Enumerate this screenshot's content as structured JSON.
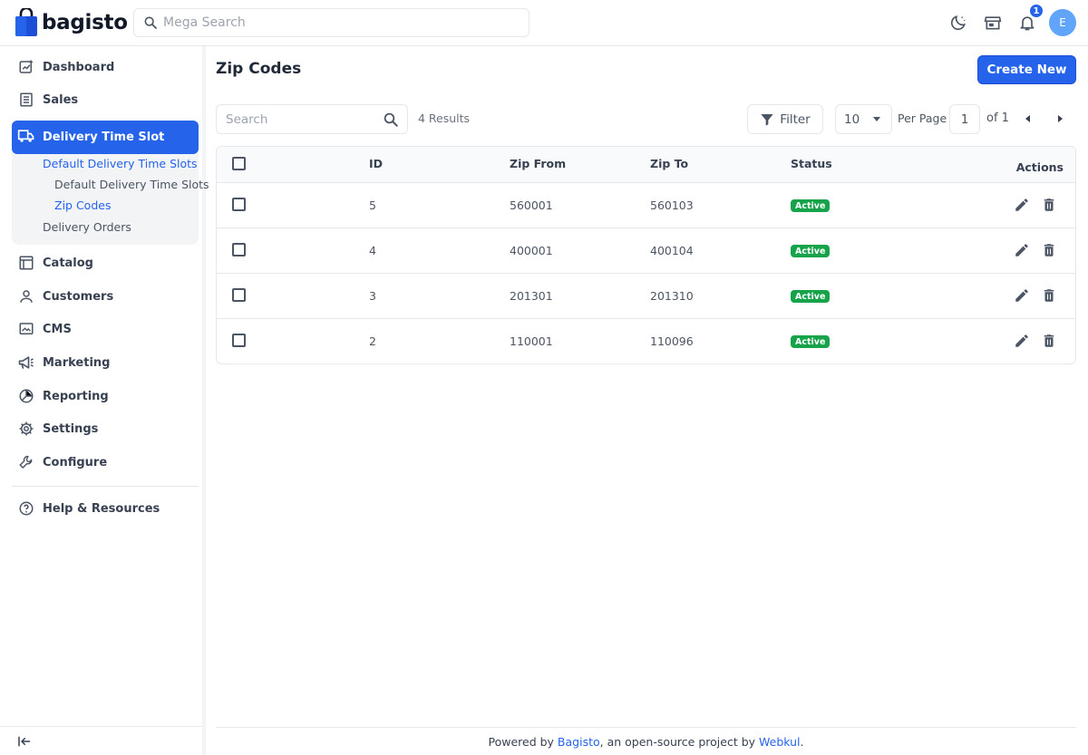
{
  "header": {
    "brand": "bagisto",
    "search_placeholder": "Mega Search",
    "notification_count": "1",
    "avatar_initial": "E"
  },
  "sidebar": {
    "items": [
      {
        "label": "Dashboard",
        "icon": "dashboard-icon"
      },
      {
        "label": "Sales",
        "icon": "sales-icon"
      },
      {
        "label": "Delivery Time Slot",
        "icon": "delivery-truck-icon"
      },
      {
        "label": "Catalog",
        "icon": "catalog-icon"
      },
      {
        "label": "Customers",
        "icon": "customers-icon"
      },
      {
        "label": "CMS",
        "icon": "cms-icon"
      },
      {
        "label": "Marketing",
        "icon": "marketing-megaphone-icon"
      },
      {
        "label": "Reporting",
        "icon": "reporting-chart-icon"
      },
      {
        "label": "Settings",
        "icon": "gear-icon"
      },
      {
        "label": "Configure",
        "icon": "wrench-icon"
      }
    ],
    "sub_items": [
      "Default Delivery Time Slots",
      "Default Delivery Time Slots",
      "Zip Codes",
      "Delivery Orders"
    ],
    "help": "Help & Resources"
  },
  "main": {
    "title": "Zip Codes",
    "create_button": "Create New",
    "search_placeholder": "Search",
    "results": "4 Results",
    "filter_label": "Filter",
    "per_page_value": "10",
    "per_page_label": "Per Page",
    "page_current": "1",
    "page_of": "of 1"
  },
  "table": {
    "headers": [
      "ID",
      "Zip From",
      "Zip To",
      "Status",
      "Actions"
    ],
    "rows": [
      {
        "id": "5",
        "zip_from": "560001",
        "zip_to": "560103",
        "status": "Active"
      },
      {
        "id": "4",
        "zip_from": "400001",
        "zip_to": "400104",
        "status": "Active"
      },
      {
        "id": "3",
        "zip_from": "201301",
        "zip_to": "201310",
        "status": "Active"
      },
      {
        "id": "2",
        "zip_from": "110001",
        "zip_to": "110096",
        "status": "Active"
      }
    ]
  },
  "footer": {
    "prefix": "Powered by ",
    "link1": "Bagisto",
    "middle": ", an open-source project by ",
    "link2": "Webkul",
    "suffix": "."
  },
  "colors": {
    "accent": "#2563eb",
    "status_active": "#16a34a"
  }
}
